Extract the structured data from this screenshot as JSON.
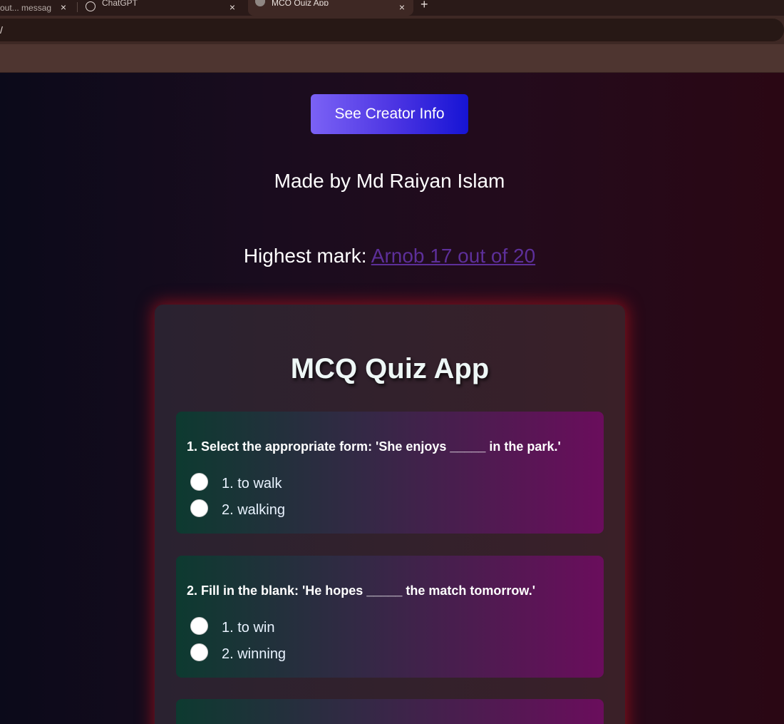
{
  "browser": {
    "tabs": [
      {
        "label": "out... messag",
        "active": false
      },
      {
        "label": "ChatGPT",
        "active": false
      },
      {
        "label": "MCQ Quiz App",
        "active": true
      }
    ],
    "new_tab_glyph": "+",
    "close_glyph": "×",
    "address": "/"
  },
  "header": {
    "creator_button_label": "See Creator Info",
    "made_by": "Made by Md Raiyan Islam",
    "highest_prefix": "Highest mark: ",
    "highest_link": "Arnob 17 out of 20"
  },
  "quiz": {
    "title": "MCQ Quiz App",
    "questions": [
      {
        "text": "1. Select the appropriate form: 'She enjoys _____ in the park.'",
        "options": [
          "1. to walk",
          "2. walking"
        ]
      },
      {
        "text": "2. Fill in the blank: 'He hopes _____ the match tomorrow.'",
        "options": [
          "1. to win",
          "2. winning"
        ]
      }
    ]
  },
  "colors": {
    "button_gradient_start": "#7b62f5",
    "button_gradient_end": "#1614d4",
    "link": "#5d2f9a",
    "card_glow": "#c8141e"
  }
}
